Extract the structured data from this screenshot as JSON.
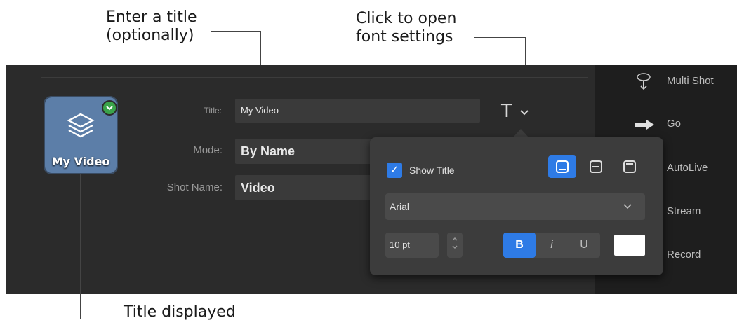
{
  "callouts": {
    "title_hint": [
      "Enter a title",
      "(optionally)"
    ],
    "font_hint": [
      "Click to open",
      "font settings"
    ],
    "title_displayed": "Title displayed"
  },
  "thumbnail": {
    "label": "My Video",
    "icon": "layers-icon",
    "badge": "check-badge-icon"
  },
  "form": {
    "title_label": "Title:",
    "title_value": "My Video",
    "mode_label": "Mode:",
    "mode_value": "By Name",
    "shot_name_label": "Shot Name:",
    "shot_name_value": "Video",
    "font_button": "T"
  },
  "font_popover": {
    "show_title_label": "Show Title",
    "show_title_checked": true,
    "positions": [
      "bottom",
      "middle",
      "top"
    ],
    "position_selected": "bottom",
    "font_family": "Arial",
    "font_size": "10 pt",
    "bold": "B",
    "italic": "i",
    "underline": "U",
    "bold_active": true,
    "text_color": "#ffffff"
  },
  "sidebar": {
    "items": [
      {
        "label": "Multi Shot",
        "icon": "multi-shot-icon"
      },
      {
        "label": "Go",
        "icon": "arrow-right-icon"
      },
      {
        "label": "AutoLive",
        "icon": ""
      },
      {
        "label": "Stream",
        "icon": ""
      },
      {
        "label": "Record",
        "icon": ""
      }
    ]
  },
  "colors": {
    "accent": "#2e7be6",
    "panel": "#2b2b2b",
    "popover": "#3c3c3c"
  }
}
